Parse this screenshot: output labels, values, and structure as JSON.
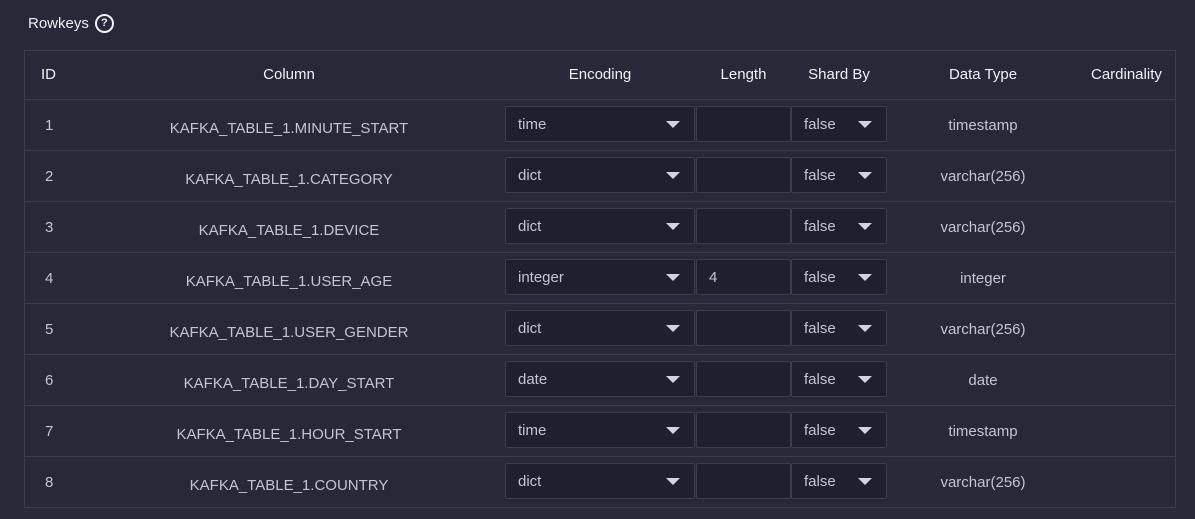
{
  "section": {
    "title": "Rowkeys",
    "help_icon": "question-circle-icon"
  },
  "table": {
    "headers": {
      "id": "ID",
      "column": "Column",
      "encoding": "Encoding",
      "length": "Length",
      "shard_by": "Shard By",
      "data_type": "Data Type",
      "cardinality": "Cardinality"
    },
    "rows": [
      {
        "id": "1",
        "column": "KAFKA_TABLE_1.MINUTE_START",
        "encoding": "time",
        "length": "",
        "shard_by": "false",
        "data_type": "timestamp",
        "cardinality": ""
      },
      {
        "id": "2",
        "column": "KAFKA_TABLE_1.CATEGORY",
        "encoding": "dict",
        "length": "",
        "shard_by": "false",
        "data_type": "varchar(256)",
        "cardinality": ""
      },
      {
        "id": "3",
        "column": "KAFKA_TABLE_1.DEVICE",
        "encoding": "dict",
        "length": "",
        "shard_by": "false",
        "data_type": "varchar(256)",
        "cardinality": ""
      },
      {
        "id": "4",
        "column": "KAFKA_TABLE_1.USER_AGE",
        "encoding": "integer",
        "length": "4",
        "shard_by": "false",
        "data_type": "integer",
        "cardinality": ""
      },
      {
        "id": "5",
        "column": "KAFKA_TABLE_1.USER_GENDER",
        "encoding": "dict",
        "length": "",
        "shard_by": "false",
        "data_type": "varchar(256)",
        "cardinality": ""
      },
      {
        "id": "6",
        "column": "KAFKA_TABLE_1.DAY_START",
        "encoding": "date",
        "length": "",
        "shard_by": "false",
        "data_type": "date",
        "cardinality": ""
      },
      {
        "id": "7",
        "column": "KAFKA_TABLE_1.HOUR_START",
        "encoding": "time",
        "length": "",
        "shard_by": "false",
        "data_type": "timestamp",
        "cardinality": ""
      },
      {
        "id": "8",
        "column": "KAFKA_TABLE_1.COUNTRY",
        "encoding": "dict",
        "length": "",
        "shard_by": "false",
        "data_type": "varchar(256)",
        "cardinality": ""
      }
    ]
  }
}
